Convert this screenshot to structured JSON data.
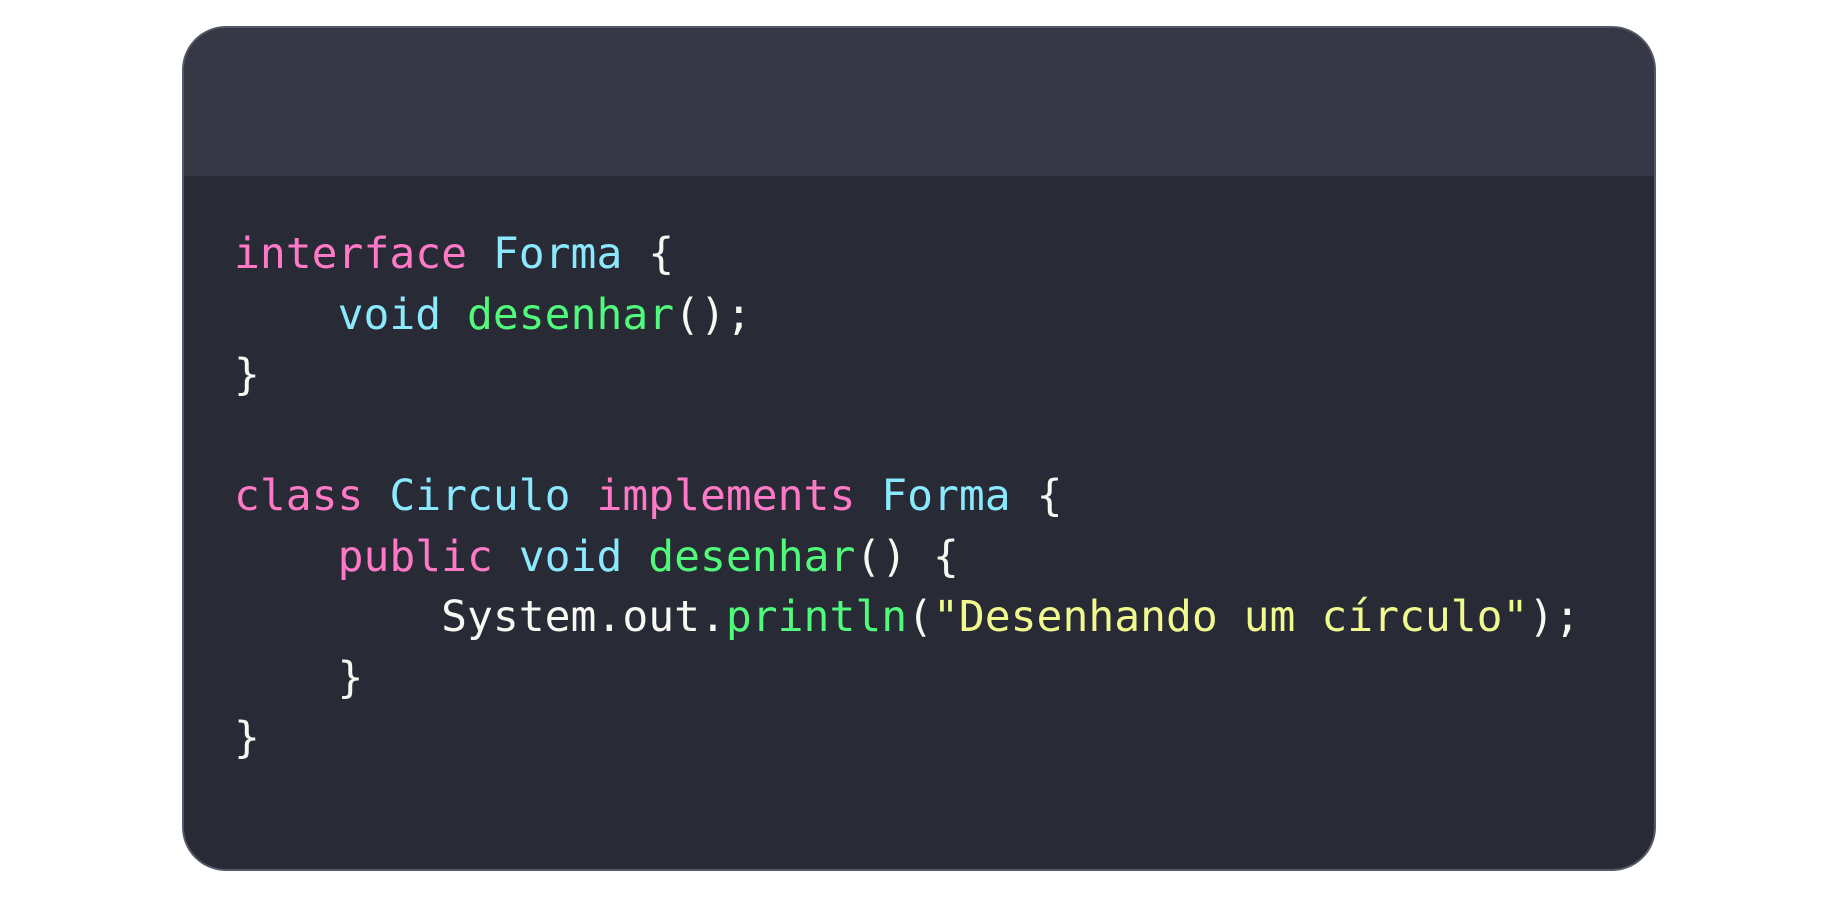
{
  "code_window": {
    "lines": [
      [
        {
          "text": "interface",
          "kind": "keyword"
        },
        {
          "text": " ",
          "kind": "plain"
        },
        {
          "text": "Forma",
          "kind": "type"
        },
        {
          "text": " {",
          "kind": "plain"
        }
      ],
      [
        {
          "text": "    ",
          "kind": "plain"
        },
        {
          "text": "void",
          "kind": "type"
        },
        {
          "text": " ",
          "kind": "plain"
        },
        {
          "text": "desenhar",
          "kind": "func"
        },
        {
          "text": "();",
          "kind": "plain"
        }
      ],
      [
        {
          "text": "}",
          "kind": "plain"
        }
      ],
      [],
      [
        {
          "text": "class",
          "kind": "keyword"
        },
        {
          "text": " ",
          "kind": "plain"
        },
        {
          "text": "Circulo",
          "kind": "type"
        },
        {
          "text": " ",
          "kind": "plain"
        },
        {
          "text": "implements",
          "kind": "keyword"
        },
        {
          "text": " ",
          "kind": "plain"
        },
        {
          "text": "Forma",
          "kind": "type"
        },
        {
          "text": " {",
          "kind": "plain"
        }
      ],
      [
        {
          "text": "    ",
          "kind": "plain"
        },
        {
          "text": "public",
          "kind": "keyword"
        },
        {
          "text": " ",
          "kind": "plain"
        },
        {
          "text": "void",
          "kind": "type"
        },
        {
          "text": " ",
          "kind": "plain"
        },
        {
          "text": "desenhar",
          "kind": "func"
        },
        {
          "text": "() {",
          "kind": "plain"
        }
      ],
      [
        {
          "text": "        System.out.",
          "kind": "plain"
        },
        {
          "text": "println",
          "kind": "func"
        },
        {
          "text": "(",
          "kind": "plain"
        },
        {
          "text": "\"Desenhando um círculo\"",
          "kind": "string"
        },
        {
          "text": ");",
          "kind": "plain"
        }
      ],
      [
        {
          "text": "    }",
          "kind": "plain"
        }
      ],
      [
        {
          "text": "}",
          "kind": "plain"
        }
      ]
    ]
  },
  "syntax_colors": {
    "background": "#282a36",
    "titlebar": "#363845",
    "keyword": "#ff79c6",
    "type": "#8be9fd",
    "func": "#50fa7b",
    "string": "#f1fa8c",
    "plain": "#f8f8f2"
  }
}
